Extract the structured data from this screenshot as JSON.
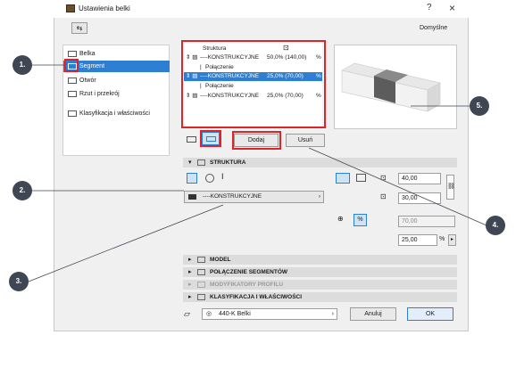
{
  "window": {
    "title": "Ustawienia belki",
    "help": "?",
    "close": "×",
    "toolbar_icon": "⇆",
    "preset": "Domyślne"
  },
  "sidebar": {
    "items": [
      {
        "label": "Belka",
        "selected": false
      },
      {
        "label": "Segment",
        "selected": true
      },
      {
        "label": "Otwór",
        "selected": false
      },
      {
        "label": "Rzut i przekrój",
        "selected": false
      },
      {
        "label": "Klasyfikacja i właściwości",
        "selected": false
      }
    ]
  },
  "segments_table": {
    "header": "Struktura",
    "rows": [
      {
        "name": "----KONSTRUKCYJNE",
        "value": "50,0% (140,00)",
        "selected": false,
        "type": "segment"
      },
      {
        "name": "Połączenie",
        "value": "",
        "selected": false,
        "type": "joint"
      },
      {
        "name": "----KONSTRUKCYJNE",
        "value": "25,0% (70,00)",
        "selected": true,
        "type": "segment"
      },
      {
        "name": "Połączenie",
        "value": "",
        "selected": false,
        "type": "joint"
      },
      {
        "name": "----KONSTRUKCYJNE",
        "value": "25,0% (70,00)",
        "selected": false,
        "type": "segment"
      }
    ]
  },
  "buttons": {
    "add": "Dodaj",
    "remove": "Usuń",
    "cancel": "Anuluj",
    "ok": "OK"
  },
  "structure": {
    "title": "STRUKTURA",
    "building_material": "----KONSTRUKCYJNE",
    "width": "40,00",
    "height": "30,00",
    "offset": "70,00",
    "percent": "25,00",
    "percent_unit": "%",
    "percent_icon": "%"
  },
  "sections": [
    {
      "label": "MODEL",
      "disabled": false
    },
    {
      "label": "POŁĄCZENIE SEGMENTÓW",
      "disabled": false
    },
    {
      "label": "MODYFIKATORY PROFILU",
      "disabled": true
    },
    {
      "label": "KLASYFIKACJA I WŁAŚCIWOŚCI",
      "disabled": false
    }
  ],
  "layer": {
    "value": "440-K Belki"
  },
  "callouts": [
    "1.",
    "2.",
    "3.",
    "4.",
    "5."
  ],
  "colors": {
    "accent": "#2d7fd3",
    "highlight": "#e0232b",
    "callout": "#3e4753"
  }
}
